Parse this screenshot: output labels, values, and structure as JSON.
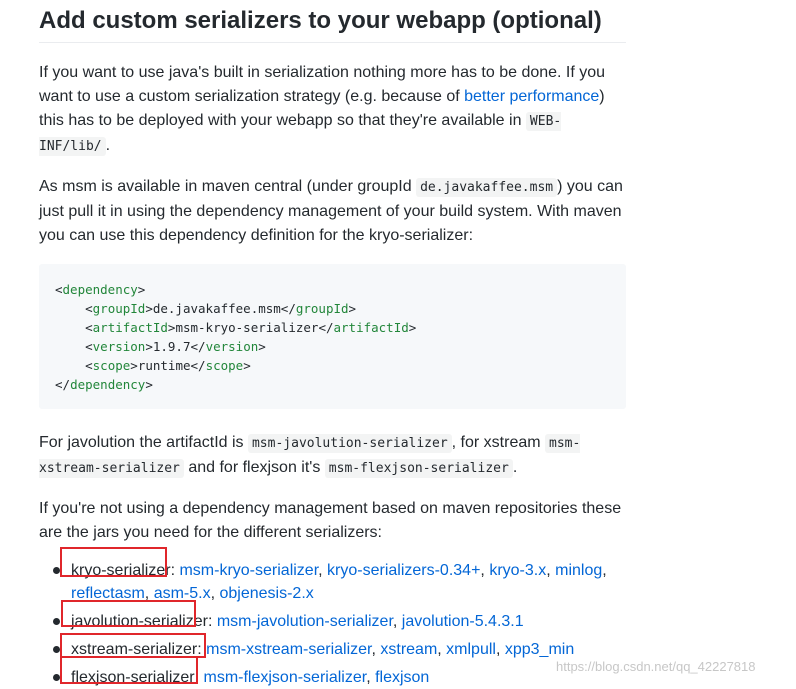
{
  "heading": "Add custom serializers to your webapp (optional)",
  "para1": {
    "text_a": "If you want to use java's built in serialization nothing more has to be done. If you want to use a custom serialization strategy (e.g. because of ",
    "link": "better performance",
    "text_b": ") this has to be deployed with your webapp so that they're available in ",
    "code": "WEB-INF/lib/",
    "text_c": "."
  },
  "para2": {
    "text_a": "As msm is available in maven central (under groupId ",
    "code": "de.javakaffee.msm",
    "text_b": ") you can just pull it in using the dependency management of your build system. With maven you can use this dependency definition for the kryo-serializer:"
  },
  "code_block": {
    "dependency_open": "dependency",
    "groupId_tag": "groupId",
    "groupId_value": "de.javakaffee.msm",
    "artifactId_tag": "artifactId",
    "artifactId_value": "msm-kryo-serializer",
    "version_tag": "version",
    "version_value": "1.9.7",
    "scope_tag": "scope",
    "scope_value": "runtime",
    "dependency_close": "dependency"
  },
  "para3": {
    "text_a": "For javolution the artifactId is ",
    "code_a": "msm-javolution-serializer",
    "text_b": ", for xstream ",
    "code_b": "msm-xstream-serializer",
    "text_c": " and for flexjson it's ",
    "code_c": "msm-flexjson-serializer",
    "text_d": "."
  },
  "para4": "If you're not using a dependency management based on maven repositories these are the jars you need for the different serializers:",
  "serializers": [
    {
      "name": "kryo-serializer",
      "links": [
        "msm-kryo-serializer",
        "kryo-serializers-0.34+",
        "kryo-3.x",
        "minlog",
        "reflectasm",
        "asm-5.x",
        "objenesis-2.x"
      ]
    },
    {
      "name": "javolution-serializer",
      "links": [
        "msm-javolution-serializer",
        "javolution-5.4.3.1"
      ]
    },
    {
      "name": "xstream-serializer",
      "links": [
        "msm-xstream-serializer",
        "xstream",
        "xmlpull",
        "xpp3_min"
      ]
    },
    {
      "name": "flexjson-serializer",
      "links": [
        "msm-flexjson-serializer",
        "flexjson"
      ]
    }
  ],
  "watermark": "https://blog.csdn.net/qq_42227818",
  "colors": {
    "link": "#0366d6",
    "highlight_box": "#e0262b",
    "code_tag": "#22863a"
  }
}
